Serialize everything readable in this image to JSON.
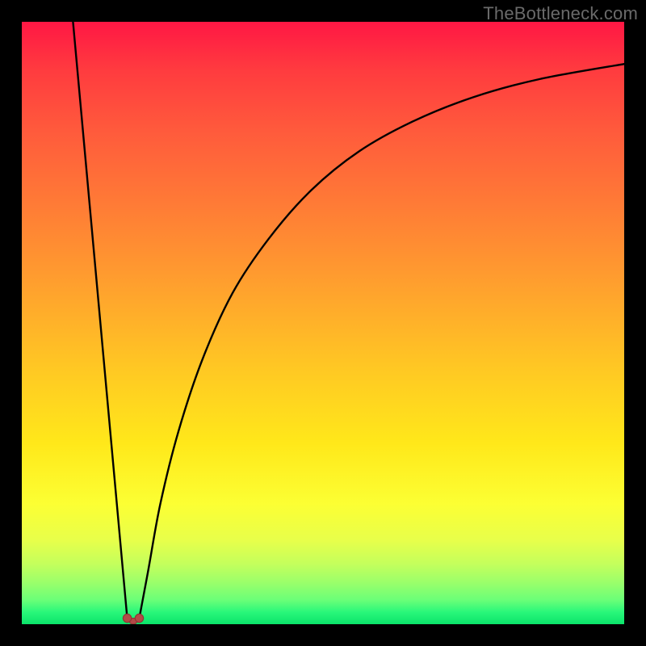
{
  "watermark": "TheBottleneck.com",
  "colors": {
    "frame_bg_top": "#ff1744",
    "frame_bg_bottom": "#0be36a",
    "curve": "#000000",
    "marker": "#b34a47",
    "page_bg": "#000000",
    "watermark": "#6a6a6a"
  },
  "chart_data": {
    "type": "line",
    "title": "",
    "xlabel": "",
    "ylabel": "",
    "xlim": [
      0,
      100
    ],
    "ylim": [
      0,
      100
    ],
    "grid": false,
    "series": [
      {
        "name": "line-left",
        "description": "steep descending segment from top-left frame down to the valley",
        "x": [
          8.5,
          17.5
        ],
        "values": [
          100,
          1
        ]
      },
      {
        "name": "curve-right",
        "description": "asymptotically rising curve from valley toward top-right",
        "x": [
          19.5,
          21,
          23,
          26,
          30,
          35,
          41,
          48,
          56,
          65,
          75,
          86,
          100
        ],
        "values": [
          1,
          9,
          20,
          32,
          44,
          55,
          64,
          72,
          78.5,
          83.5,
          87.5,
          90.5,
          93
        ]
      }
    ],
    "markers": [
      {
        "name": "valley-marker-left",
        "x": 17.5,
        "y": 1
      },
      {
        "name": "valley-marker-right",
        "x": 19.5,
        "y": 1
      }
    ],
    "valley_bridge": {
      "description": "short U-shaped connector between the two marker points at the valley floor",
      "x": [
        17.5,
        18.0,
        18.5,
        19.0,
        19.5
      ],
      "values": [
        1.0,
        0.2,
        0.0,
        0.2,
        1.0
      ]
    }
  }
}
